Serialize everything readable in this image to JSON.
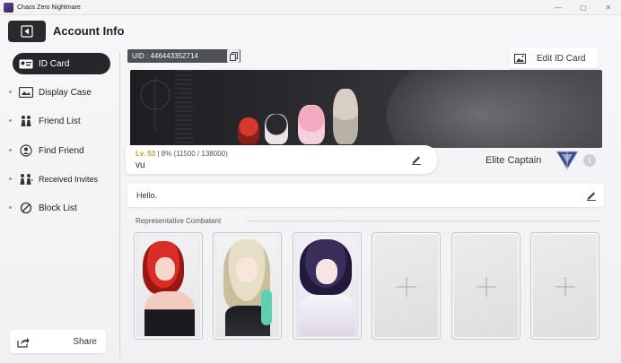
{
  "window": {
    "title": "Chaos Zero Nightmare",
    "controls": [
      "—",
      "▢",
      "✕"
    ]
  },
  "header": {
    "title": "Account Info"
  },
  "sidebar": {
    "items": [
      {
        "label": "ID Card",
        "icon": "id-card-icon",
        "active": true
      },
      {
        "label": "Display Case",
        "icon": "display-case-icon",
        "active": false
      },
      {
        "label": "Friend List",
        "icon": "friends-icon",
        "active": false
      },
      {
        "label": "Find Friend",
        "icon": "find-friend-icon",
        "active": false
      },
      {
        "label": "Received Invites",
        "icon": "invites-icon",
        "active": false
      },
      {
        "label": "Block List",
        "icon": "block-icon",
        "active": false
      }
    ],
    "share_label": "Share"
  },
  "profile": {
    "uid": "UID : 446443352714",
    "edit_card_label": "Edit ID Card",
    "level": "Lv. 53",
    "exp_text": "| 8% (11500 / 138000)",
    "name": "vu",
    "rank": "Elite Captain",
    "greeting": "Hello."
  },
  "combatants": {
    "section_label": "Representative Combatant",
    "slots": [
      {
        "filled": true,
        "name": "red-haired-combatant"
      },
      {
        "filled": true,
        "name": "blonde-horned-combatant"
      },
      {
        "filled": true,
        "name": "purple-haired-combatant"
      },
      {
        "filled": false
      },
      {
        "filled": false
      },
      {
        "filled": false
      }
    ]
  },
  "colors": {
    "accent_dark": "#26272b",
    "level_gold": "#c99a2e",
    "uid_bg": "#505058"
  }
}
